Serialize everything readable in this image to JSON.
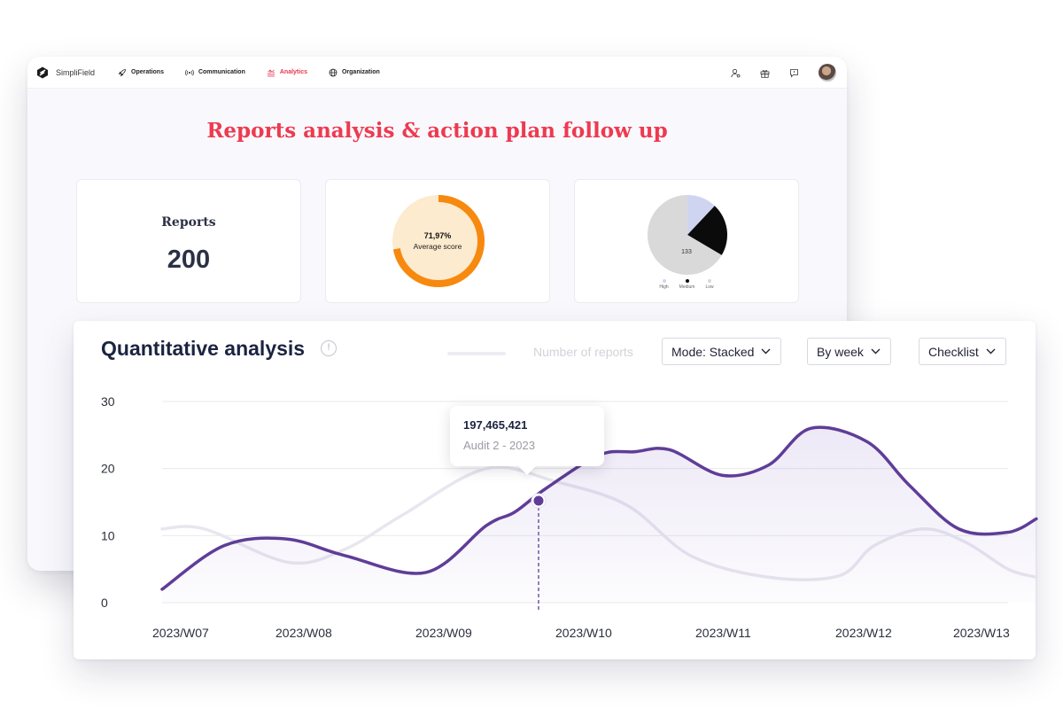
{
  "app": {
    "brand": "SimpliField",
    "nav": [
      {
        "label": "Operations",
        "icon": "rocket-icon",
        "active": false
      },
      {
        "label": "Communication",
        "icon": "broadcast-icon",
        "active": false
      },
      {
        "label": "Analytics",
        "icon": "analytics-icon",
        "active": true
      },
      {
        "label": "Organization",
        "icon": "globe-icon",
        "active": false
      }
    ],
    "toolbar_icons": [
      "user-settings-icon",
      "gift-icon",
      "chat-icon",
      "avatar"
    ],
    "accent_color": "#ee3a50"
  },
  "page": {
    "title": "Reports analysis & action plan follow up"
  },
  "kpis": {
    "reports": {
      "label": "Reports",
      "value": "200"
    },
    "score": {
      "percent_text": "71,97%",
      "label": "Average score",
      "fraction": 0.7197,
      "color": "#f7890f"
    },
    "priority_pie": {
      "center_label": "133",
      "slices": [
        {
          "name": "High",
          "value": 24,
          "color": "#cfd5f1"
        },
        {
          "name": "Medium",
          "value": 43,
          "color": "#0b0b0b"
        },
        {
          "name": "Low",
          "value": 133,
          "color": "#d9d9d9"
        }
      ]
    }
  },
  "analysis": {
    "title": "Quantitative analysis",
    "info_icon": "info-icon",
    "legend_label": "Number of reports",
    "dropdowns": {
      "mode": "Mode: Stacked",
      "period": "By week",
      "checklist": "Checklist"
    },
    "tooltip": {
      "value": "197,465,421",
      "label": "Audit 2 - 2023"
    }
  },
  "chart_data": {
    "type": "area",
    "x": [
      "2023/W07",
      "2023/W08",
      "2023/W09",
      "2023/W10",
      "2023/W11",
      "2023/W12",
      "2023/W13"
    ],
    "ylim": [
      0,
      30
    ],
    "yticks": [
      0,
      10,
      20,
      30
    ],
    "grid": true,
    "series": [
      {
        "name": "Number of reports",
        "color": "#5f3d97",
        "points": [
          [
            0,
            2
          ],
          [
            0.44,
            8.5
          ],
          [
            0.88,
            9.5
          ],
          [
            1.3,
            7
          ],
          [
            1.87,
            4.5
          ],
          [
            2.3,
            11.5
          ],
          [
            2.5,
            13.5
          ],
          [
            2.72,
            17
          ],
          [
            3.1,
            22
          ],
          [
            3.35,
            22.5
          ],
          [
            3.6,
            22.8
          ],
          [
            3.97,
            19
          ],
          [
            4.3,
            20.5
          ],
          [
            4.6,
            26
          ],
          [
            5,
            24
          ],
          [
            5.3,
            17.5
          ],
          [
            5.65,
            11
          ],
          [
            6,
            10.5
          ],
          [
            6.2,
            12.5
          ]
        ]
      },
      {
        "name": "",
        "color": "#e8e6ef",
        "points": [
          [
            0,
            11
          ],
          [
            0.3,
            11
          ],
          [
            0.9,
            6
          ],
          [
            1.3,
            8
          ],
          [
            1.7,
            13
          ],
          [
            2.3,
            20
          ],
          [
            2.8,
            18
          ],
          [
            3.3,
            14.5
          ],
          [
            3.75,
            7
          ],
          [
            4.3,
            3.8
          ],
          [
            4.8,
            4
          ],
          [
            5.05,
            8.5
          ],
          [
            5.4,
            11
          ],
          [
            5.7,
            9
          ],
          [
            6,
            5
          ],
          [
            6.2,
            3.8
          ]
        ]
      }
    ],
    "highlight": {
      "x": 2.67,
      "y": 15.2
    }
  }
}
